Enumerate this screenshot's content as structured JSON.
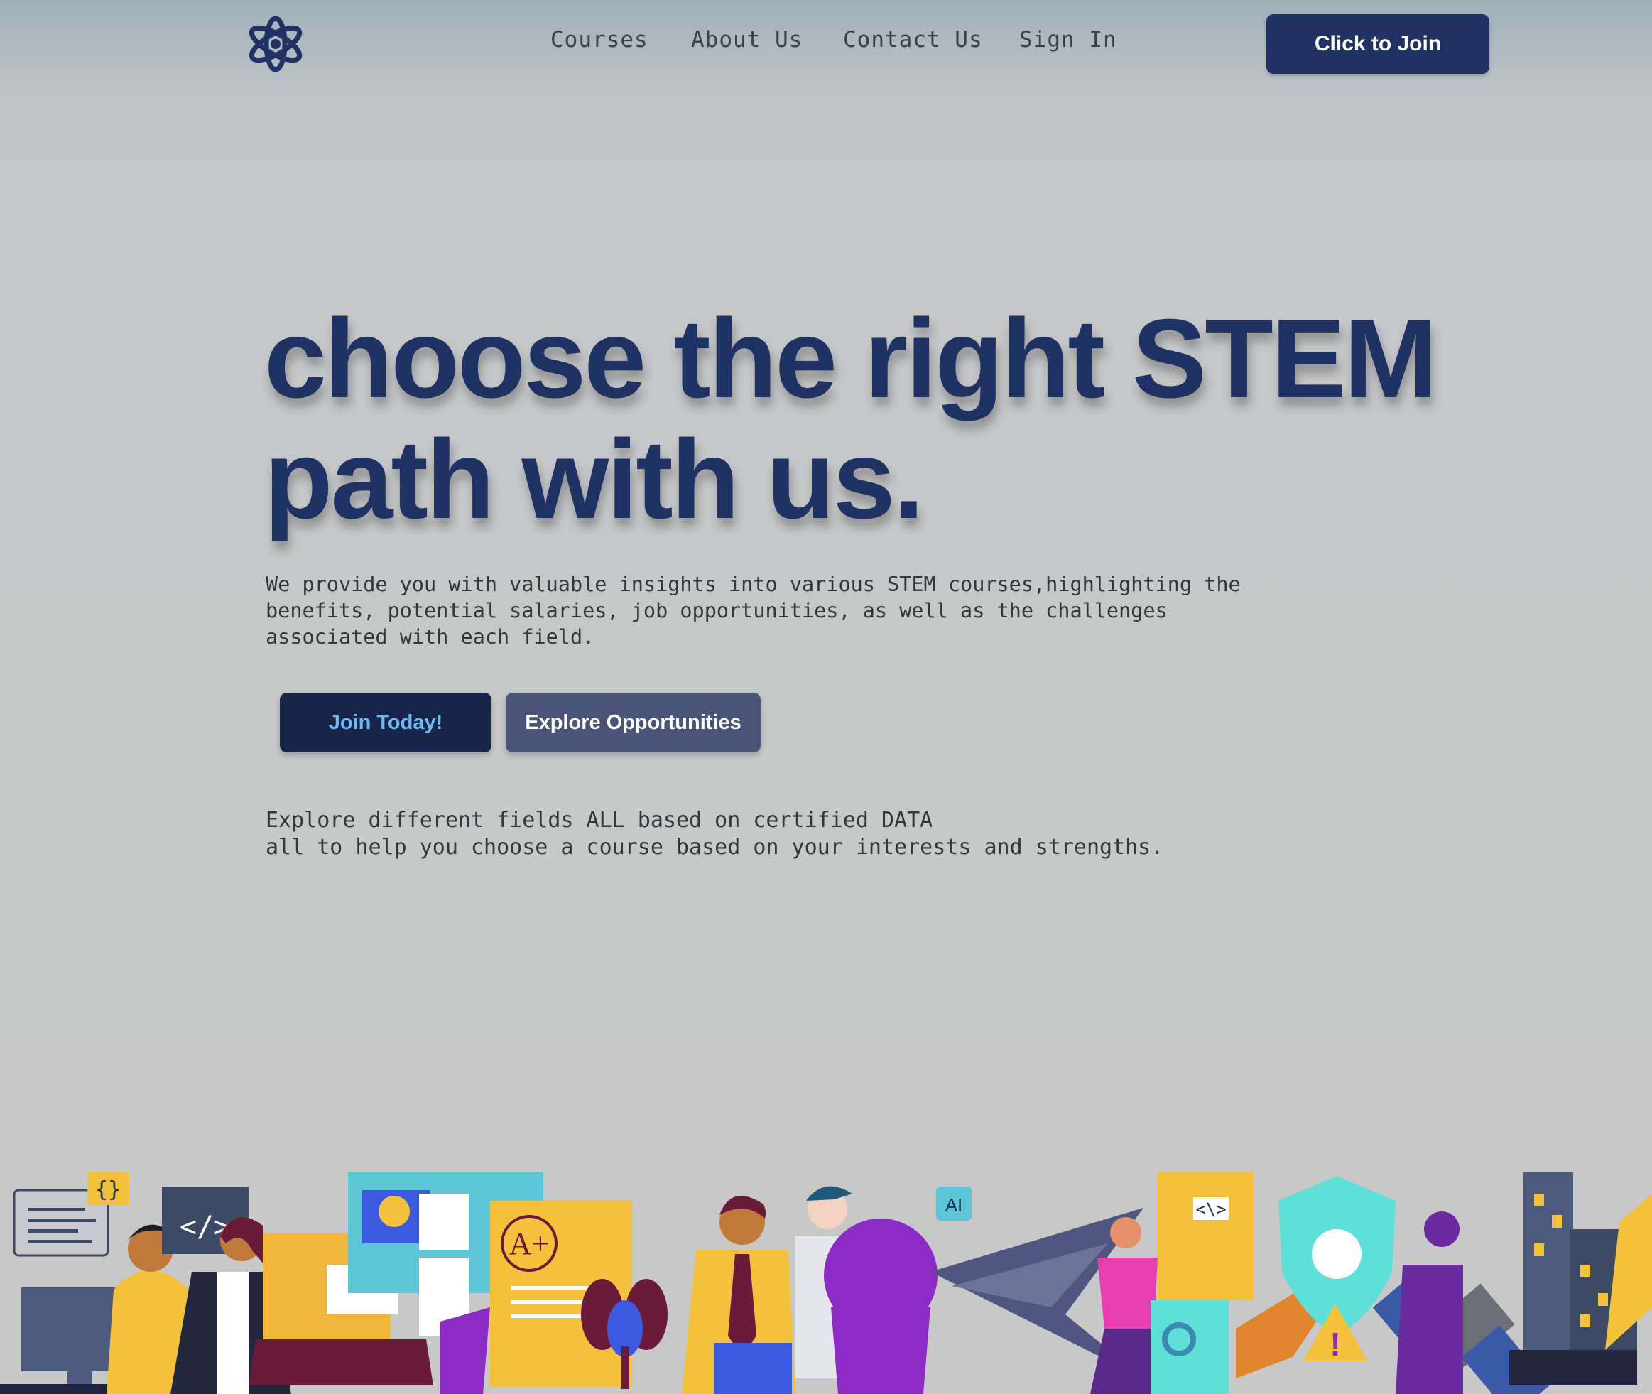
{
  "header": {
    "logo": "atom-logo-icon",
    "nav": [
      {
        "label": "Courses"
      },
      {
        "label": "About Us"
      },
      {
        "label": "Contact Us"
      },
      {
        "label": "Sign In"
      }
    ],
    "cta_label": "Click to Join"
  },
  "hero": {
    "title": "choose the right STEM path with us.",
    "description": "We provide you with valuable insights into various STEM courses,highlighting the\nbenefits, potential salaries, job opportunities, as well as the challenges\nassociated with each field.",
    "join_label": "Join Today!",
    "explore_label": "Explore Opportunities",
    "subtext": "Explore different fields ALL based on certified DATA\nall to help you choose a course based on your interests and strengths."
  },
  "illustration": {
    "labels": {
      "braces": "{}",
      "code": "</>",
      "grade": "A+",
      "ai": "AI",
      "code2": "<\\>",
      "alert": "!"
    }
  },
  "colors": {
    "primary": "#1f3263",
    "join_text": "#6fb8f0",
    "explore_bg": "#495477",
    "page_bg": "#c8c8c8"
  }
}
